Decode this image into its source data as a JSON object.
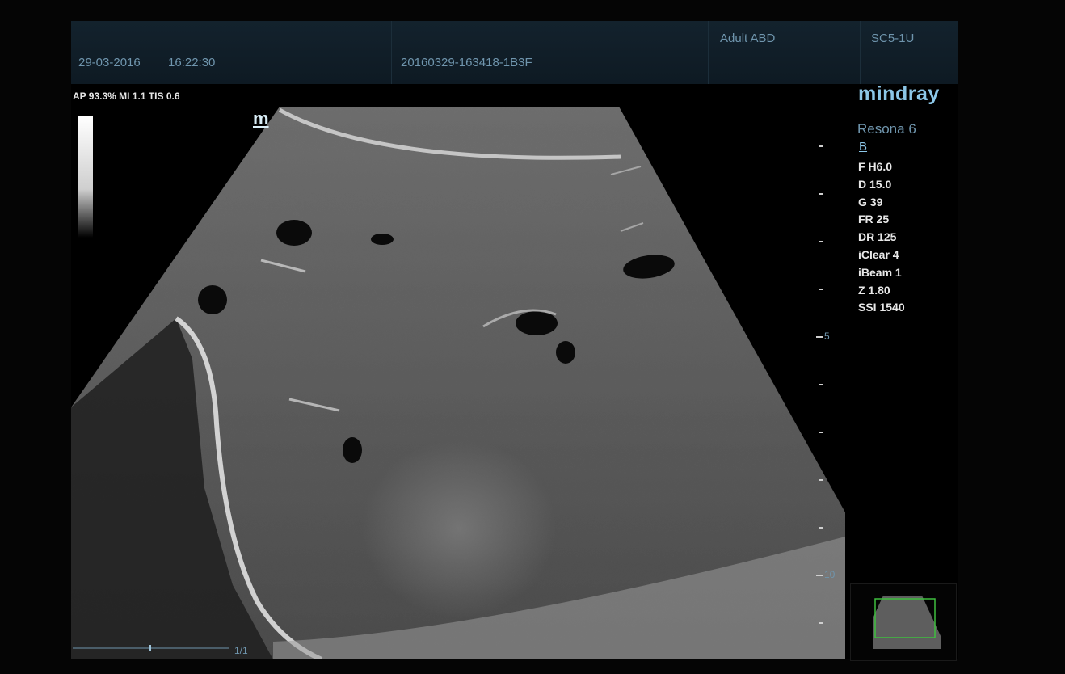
{
  "header": {
    "date": "29-03-2016",
    "time": "16:22:30",
    "patient_id": "20160329-163418-1B3F",
    "exam_preset": "Adult ABD",
    "probe": "SC5-1U"
  },
  "acoustic_output": "AP 93.3%  MI 1.1 TIS 0.6",
  "brand": "mindray",
  "system_model": "Resona 6",
  "imaging_mode": "B",
  "orientation_marker": "m",
  "parameters": [
    "F H6.0",
    "D 15.0",
    "G 39",
    "FR 25",
    "DR 125",
    "iClear 4",
    "iBeam 1",
    "Z 1.80",
    "SSI 1540"
  ],
  "depth_scale": {
    "labels": [
      "5",
      "10"
    ]
  },
  "cine": {
    "frame_label": "1/1"
  },
  "colors": {
    "header_text": "#6f95ad",
    "brand_blue": "#8cc7e8",
    "param_text": "#e8e8e8",
    "thumbnail_box": "#3fbf3f"
  }
}
